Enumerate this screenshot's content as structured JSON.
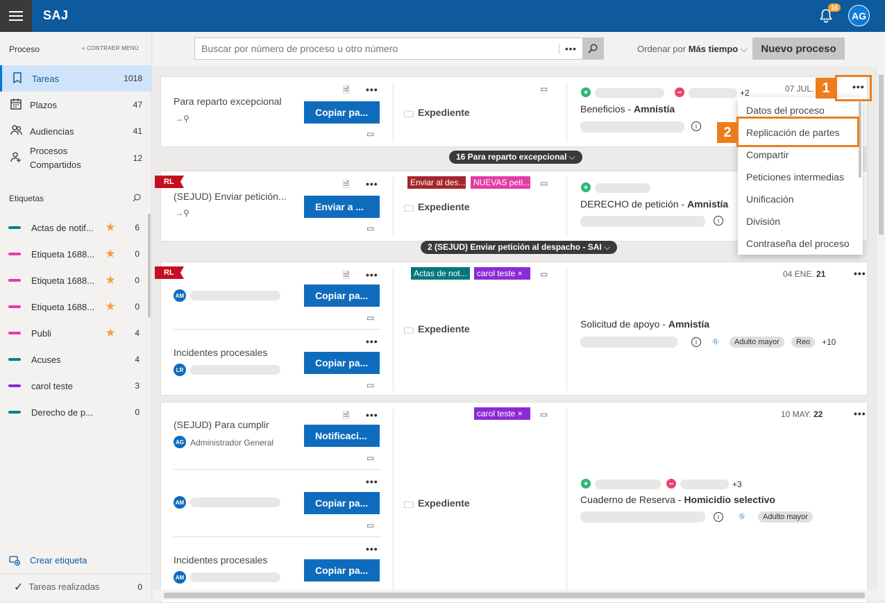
{
  "app": {
    "brand": "SAJ",
    "notifications": "16",
    "user_initials": "AG"
  },
  "sidebar": {
    "header": "Proceso",
    "collapse": "CONTRAER MENÚ",
    "items": [
      {
        "label": "Tareas",
        "count": "1018",
        "icon": "bookmark-icon"
      },
      {
        "label": "Plazos",
        "count": "47",
        "icon": "calendar-icon"
      },
      {
        "label": "Audiencias",
        "count": "41",
        "icon": "people-icon"
      },
      {
        "label": "Procesos\nCompartidos",
        "count": "12",
        "icon": "shared-people-icon"
      }
    ],
    "tags_header": "Etiquetas",
    "tags": [
      {
        "label": "Actas de notif...",
        "count": "6",
        "color": "#038387",
        "star": true
      },
      {
        "label": "Etiqueta 1688...",
        "count": "0",
        "color": "#e43ba6",
        "star": true
      },
      {
        "label": "Etiqueta 1688...",
        "count": "0",
        "color": "#e43ba6",
        "star": true
      },
      {
        "label": "Etiqueta 1688...",
        "count": "0",
        "color": "#e43ba6",
        "star": true
      },
      {
        "label": "Publi",
        "count": "4",
        "color": "#e43ba6",
        "star": true
      },
      {
        "label": "Acuses",
        "count": "4",
        "color": "#038387",
        "star": false
      },
      {
        "label": "carol teste",
        "count": "3",
        "color": "#8a2bd6",
        "star": false
      },
      {
        "label": "Derecho de p...",
        "count": "0",
        "color": "#038387",
        "star": false
      }
    ],
    "create_label": "Crear etiqueta",
    "done_label": "Tareas realizadas",
    "done_count": "0"
  },
  "toolbar": {
    "search_placeholder": "Buscar por número de proceso u otro número",
    "order_prefix": "Ordenar por",
    "order_value": "Más tiempo",
    "new_button": "Nuevo proceso"
  },
  "cards": [
    {
      "title": "Para reparto excepcional",
      "button": "Copiar pa...",
      "expediente": "Expediente",
      "date": "07 JUL. 2",
      "subject": "Beneficios",
      "subject_bold": "Amnistía",
      "extra": "+2",
      "group": "16 Para reparto excepcional"
    },
    {
      "title": "(SEJUD) Enviar petición...",
      "button": "Enviar a ...",
      "expediente": "Expediente",
      "badge": "RL",
      "tag1": "Enviar al des...",
      "tag2": "NUEVAS peti...",
      "subject": "DERECHO de petición",
      "subject_bold": "Amnistía",
      "group": "2 (SEJUD) Enviar petición al despacho - SAI"
    },
    {
      "title2": "Incidentes procesales",
      "button": "Copiar pa...",
      "expediente": "Expediente",
      "badge": "RL",
      "tag1": "Actas de not...",
      "tag2": "carol teste",
      "date": "04 ENE.",
      "date_bold": "21",
      "subject": "Solicitud de apoyo",
      "subject_bold": "Amnistía",
      "pill1": "Adulto mayor",
      "pill2": "Reo",
      "extra": "+10",
      "av1": "AM",
      "av2": "LR"
    },
    {
      "title": "(SEJUD) Para cumplir",
      "owner": "Administrador General",
      "button1": "Notificaci...",
      "button": "Copiar pa...",
      "title2": "Incidentes procesales",
      "expediente": "Expediente",
      "tag2": "carol teste",
      "date": "10 MAY.",
      "date_bold": "22",
      "subject": "Cuaderno de Reserva",
      "subject_bold": "Homicidio selectivo",
      "pill1": "Adulto mayor",
      "extra": "+3",
      "av0": "AG",
      "av1": "AM"
    }
  ],
  "menu": {
    "items": [
      "Datos del proceso",
      "Replicación de partes",
      "Compartir",
      "Peticiones intermedias",
      "Unificación",
      "División",
      "Contraseña del proceso"
    ],
    "step1": "1",
    "step2": "2"
  }
}
